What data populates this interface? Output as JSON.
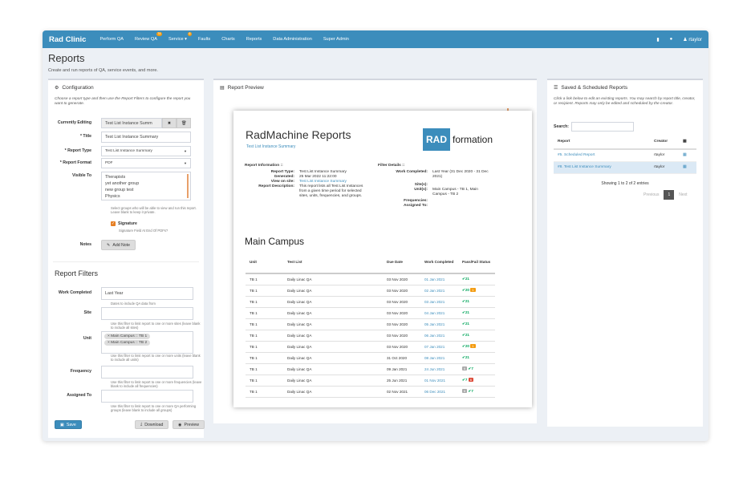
{
  "nav": {
    "brand": "Rad Clinic",
    "items": [
      {
        "label": "Perform QA",
        "badge": ""
      },
      {
        "label": "Review QA",
        "badge": "74"
      },
      {
        "label": "Service ▾",
        "badge": "6"
      },
      {
        "label": "Faults",
        "badge": ""
      },
      {
        "label": "Charts",
        "badge": ""
      },
      {
        "label": "Reports",
        "badge": ""
      },
      {
        "label": "Data Administration",
        "badge": ""
      },
      {
        "label": "Super Admin",
        "badge": ""
      }
    ],
    "user": "rtaylor"
  },
  "page": {
    "title": "Reports",
    "subtitle": "Create and run reports of QA, service events, and more."
  },
  "config": {
    "title": "Configuration",
    "help": "Choose a report type and then use the Report Filters to configure the report you want to generate.",
    "currently_editing_label": "Currently Editing",
    "currently_editing_value": "Test List Instance Summ",
    "title_label": "* Title",
    "title_value": "Test List Instance Summary",
    "report_type_label": "* Report Type",
    "report_type_value": "Test List Instance Summary",
    "report_format_label": "* Report Format",
    "report_format_value": "PDF",
    "visible_to_label": "Visible To",
    "visible_to_options": [
      "Therapists",
      "yet another group",
      "new group test",
      "Physics"
    ],
    "visible_help": "Select groups who will be able to view and run this report. Leave blank to keep it private.",
    "signature_label": "Signature",
    "signature_help": "Signature Field At End Of PDFs?",
    "notes_label": "Notes",
    "add_note": "Add Note"
  },
  "filters": {
    "title": "Report Filters",
    "work_completed_label": "Work Completed",
    "work_completed_value": "Last Year",
    "work_completed_help": "Dates to include QA data from",
    "site_label": "Site",
    "site_help": "Use this filter to limit report to one or more sites (leave blank to include all sites)",
    "unit_label": "Unit",
    "unit_tags": [
      "Main Campus :: TB 1",
      "Main Campus :: TB 2"
    ],
    "unit_help": "Use this filter to limit report to one or more units (leave blank to include all units)",
    "frequency_label": "Frequency",
    "frequency_help": "Use this filter to limit report to one or more frequencies (leave blank to include all frequencies)",
    "assigned_label": "Assigned To",
    "assigned_help": "Use this filter to limit report to one or more QA performing groups (leave blank to include all groups)",
    "save": "Save",
    "download": "Download",
    "preview": "Preview"
  },
  "preview": {
    "title": "Report Preview",
    "doc_title": "RadMachine Reports",
    "doc_subtitle": "Test List Instance Summary",
    "logo_left": "RAD",
    "logo_right": "formation",
    "info_header": "Report Information ::",
    "info": [
      {
        "k": "Report Type:",
        "v": "Test List Instance Summary",
        "link": false
      },
      {
        "k": "Generated:",
        "v": "25 Mar 2022 11:22:00",
        "link": false
      },
      {
        "k": "View on site:",
        "v": "Test List Instance Summary",
        "link": true
      },
      {
        "k": "Report Description:",
        "v": "This report lists all Test List Instances from a given time period for selected sites, units, frequencies, and groups.",
        "link": false
      }
    ],
    "filter_header": "Filter Details ::",
    "filter_details": [
      {
        "k": "Work Completed:",
        "v": "Last Year (31 Dec 2020 - 31 Dec 2021)"
      },
      {
        "k": "Site(s):",
        "v": ""
      },
      {
        "k": "Unit(s):",
        "v": "Main Campus - TB 1, Main Campus - TB 2"
      },
      {
        "k": "Frequencies:",
        "v": ""
      },
      {
        "k": "Assigned To:",
        "v": ""
      }
    ],
    "section_title": "Main Campus",
    "columns": [
      "Unit",
      "Test List",
      "Due Date",
      "Work Completed",
      "Pass/Fail Status"
    ],
    "rows": [
      {
        "unit": "TB 1",
        "list": "Daily Linac QA",
        "due": "03 Nov 2020",
        "done": "01 Jan 2021",
        "pre": "",
        "pre_type": "",
        "pass": "21",
        "post": "",
        "post_type": ""
      },
      {
        "unit": "TB 1",
        "list": "Daily Linac QA",
        "due": "03 Nov 2020",
        "done": "02 Jan 2021",
        "pre": "",
        "pre_type": "",
        "pass": "20",
        "post": "1",
        "post_type": "warn"
      },
      {
        "unit": "TB 1",
        "list": "Daily Linac QA",
        "due": "03 Nov 2020",
        "done": "03 Jan 2021",
        "pre": "",
        "pre_type": "",
        "pass": "21",
        "post": "",
        "post_type": ""
      },
      {
        "unit": "TB 1",
        "list": "Daily Linac QA",
        "due": "03 Nov 2020",
        "done": "04 Jan 2021",
        "pre": "",
        "pre_type": "",
        "pass": "21",
        "post": "",
        "post_type": ""
      },
      {
        "unit": "TB 1",
        "list": "Daily Linac QA",
        "due": "03 Nov 2020",
        "done": "05 Jan 2021",
        "pre": "",
        "pre_type": "",
        "pass": "21",
        "post": "",
        "post_type": ""
      },
      {
        "unit": "TB 1",
        "list": "Daily Linac QA",
        "due": "03 Nov 2020",
        "done": "06 Jan 2021",
        "pre": "",
        "pre_type": "",
        "pass": "21",
        "post": "",
        "post_type": ""
      },
      {
        "unit": "TB 1",
        "list": "Daily Linac QA",
        "due": "03 Nov 2020",
        "done": "07 Jan 2021",
        "pre": "",
        "pre_type": "",
        "pass": "20",
        "post": "1",
        "post_type": "warn"
      },
      {
        "unit": "TB 1",
        "list": "Daily Linac QA",
        "due": "31 Oct 2020",
        "done": "08 Jan 2021",
        "pre": "",
        "pre_type": "",
        "pass": "21",
        "post": "",
        "post_type": ""
      },
      {
        "unit": "TB 1",
        "list": "Daily Linac QA",
        "due": "09 Jan 2021",
        "done": "24 Jun 2021",
        "pre": "6",
        "pre_type": "grey",
        "pass": "7",
        "post": "",
        "post_type": ""
      },
      {
        "unit": "TB 1",
        "list": "Daily Linac QA",
        "due": "25 Jun 2021",
        "done": "01 Nov 2021",
        "pre": "",
        "pre_type": "",
        "pass": "7",
        "post": "6",
        "post_type": "fail"
      },
      {
        "unit": "TB 1",
        "list": "Daily Linac QA",
        "due": "02 Nov 2021",
        "done": "06 Dec 2021",
        "pre": "6",
        "pre_type": "grey",
        "pass": "7",
        "post": "",
        "post_type": ""
      }
    ]
  },
  "saved": {
    "title": "Saved & Scheduled Reports",
    "help": "Click a link below to edit an existing reports. You may search by report title, creator, or recipient. Reports may only be edited and scheduled by the creator.",
    "search_label": "Search:",
    "columns": [
      "Report",
      "Creator"
    ],
    "rows": [
      {
        "report": "#5. Scheduled Report",
        "creator": "rtaylor"
      },
      {
        "report": "#8. Test List Instance Summary",
        "creator": "rtaylor"
      }
    ],
    "showing": "Showing 1 to 2 of 2 entries",
    "previous": "Previous",
    "page": "1",
    "next": "Next"
  },
  "colors": {
    "accent": "#3c8dbc",
    "pass": "#00a65a",
    "warn": "#f39c12",
    "fail": "#dd4b39"
  }
}
